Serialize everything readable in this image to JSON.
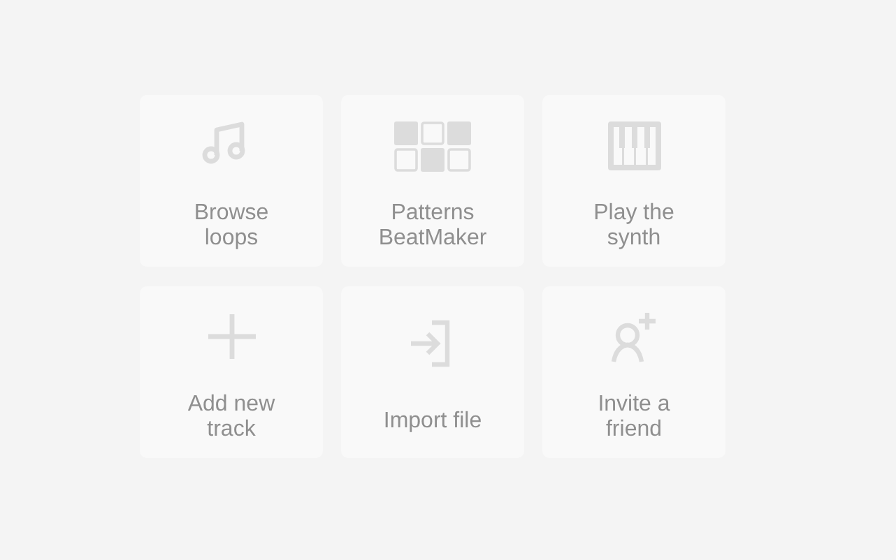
{
  "tiles": [
    {
      "kind": "music",
      "lines": [
        "Browse",
        "loops"
      ]
    },
    {
      "kind": "pads",
      "lines": [
        "Patterns",
        "BeatMaker"
      ]
    },
    {
      "kind": "piano",
      "lines": [
        "Play the",
        "synth"
      ]
    },
    {
      "kind": "plus",
      "lines": [
        "Add new",
        "track"
      ]
    },
    {
      "kind": "import",
      "lines": [
        "Import file"
      ]
    },
    {
      "kind": "invite",
      "lines": [
        "Invite a",
        "friend"
      ]
    }
  ]
}
